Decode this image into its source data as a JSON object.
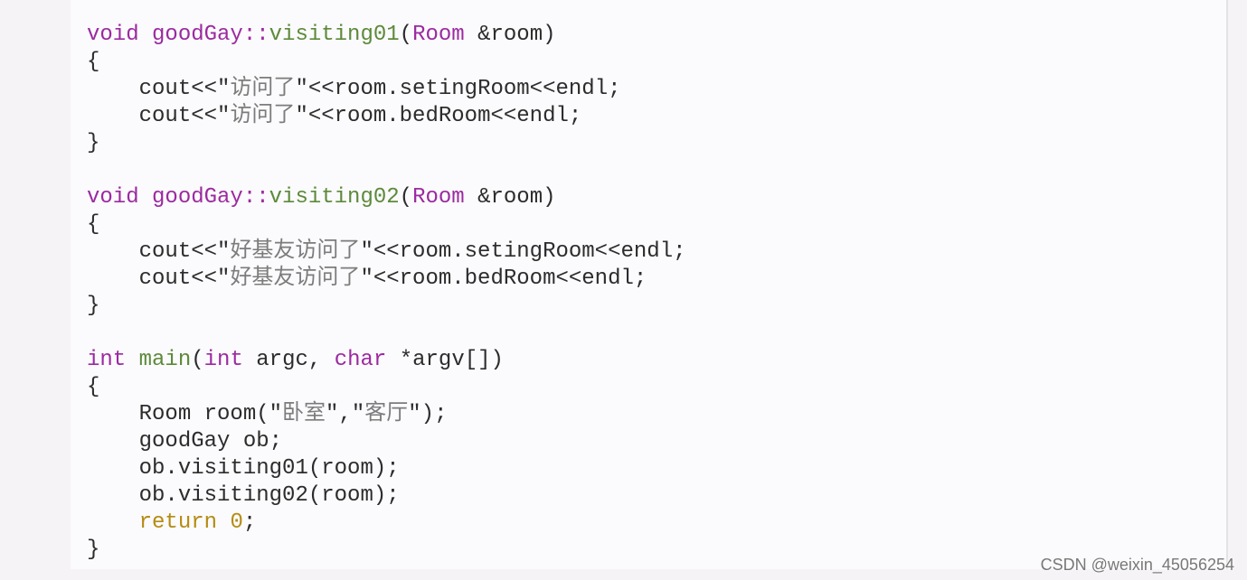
{
  "code": {
    "fn1": {
      "ret": "void",
      "qual": "goodGay::",
      "name": "visiting01",
      "params_open": "(",
      "param_type": "Room",
      "param_amp": " &",
      "param_name": "room",
      "params_close": ")",
      "brace_open": "{",
      "body1_a": "cout<<\"",
      "body1_str": "访问了",
      "body1_b": "\"<<room.setingRoom<<endl;",
      "body2_a": "cout<<\"",
      "body2_str": "访问了",
      "body2_b": "\"<<room.bedRoom<<endl;",
      "brace_close": "}"
    },
    "fn2": {
      "ret": "void",
      "qual": "goodGay::",
      "name": "visiting02",
      "params_open": "(",
      "param_type": "Room",
      "param_amp": " &",
      "param_name": "room",
      "params_close": ")",
      "brace_open": "{",
      "body1_a": "cout<<\"",
      "body1_str": "好基友访问了",
      "body1_b": "\"<<room.setingRoom<<endl;",
      "body2_a": "cout<<\"",
      "body2_str": "好基友访问了",
      "body2_b": "\"<<room.bedRoom<<endl;",
      "brace_close": "}"
    },
    "main": {
      "ret": "int",
      "name": "main",
      "params_open": "(",
      "p1_type": "int",
      "p1_name": " argc, ",
      "p2_type": "char",
      "p2_star": " *",
      "p2_name": "argv[]",
      "params_close": ")",
      "brace_open": "{",
      "l1_a": "Room room(\"",
      "l1_s1": "卧室",
      "l1_b": "\",\"",
      "l1_s2": "客厅",
      "l1_c": "\");",
      "l2": "goodGay ob;",
      "l3": "ob.visiting01(room);",
      "l4": "ob.visiting02(room);",
      "l5_a": "return ",
      "l5_num": "0",
      "l5_b": ";",
      "brace_close": "}"
    }
  },
  "watermark": "CSDN @weixin_45056254",
  "indent": "    "
}
